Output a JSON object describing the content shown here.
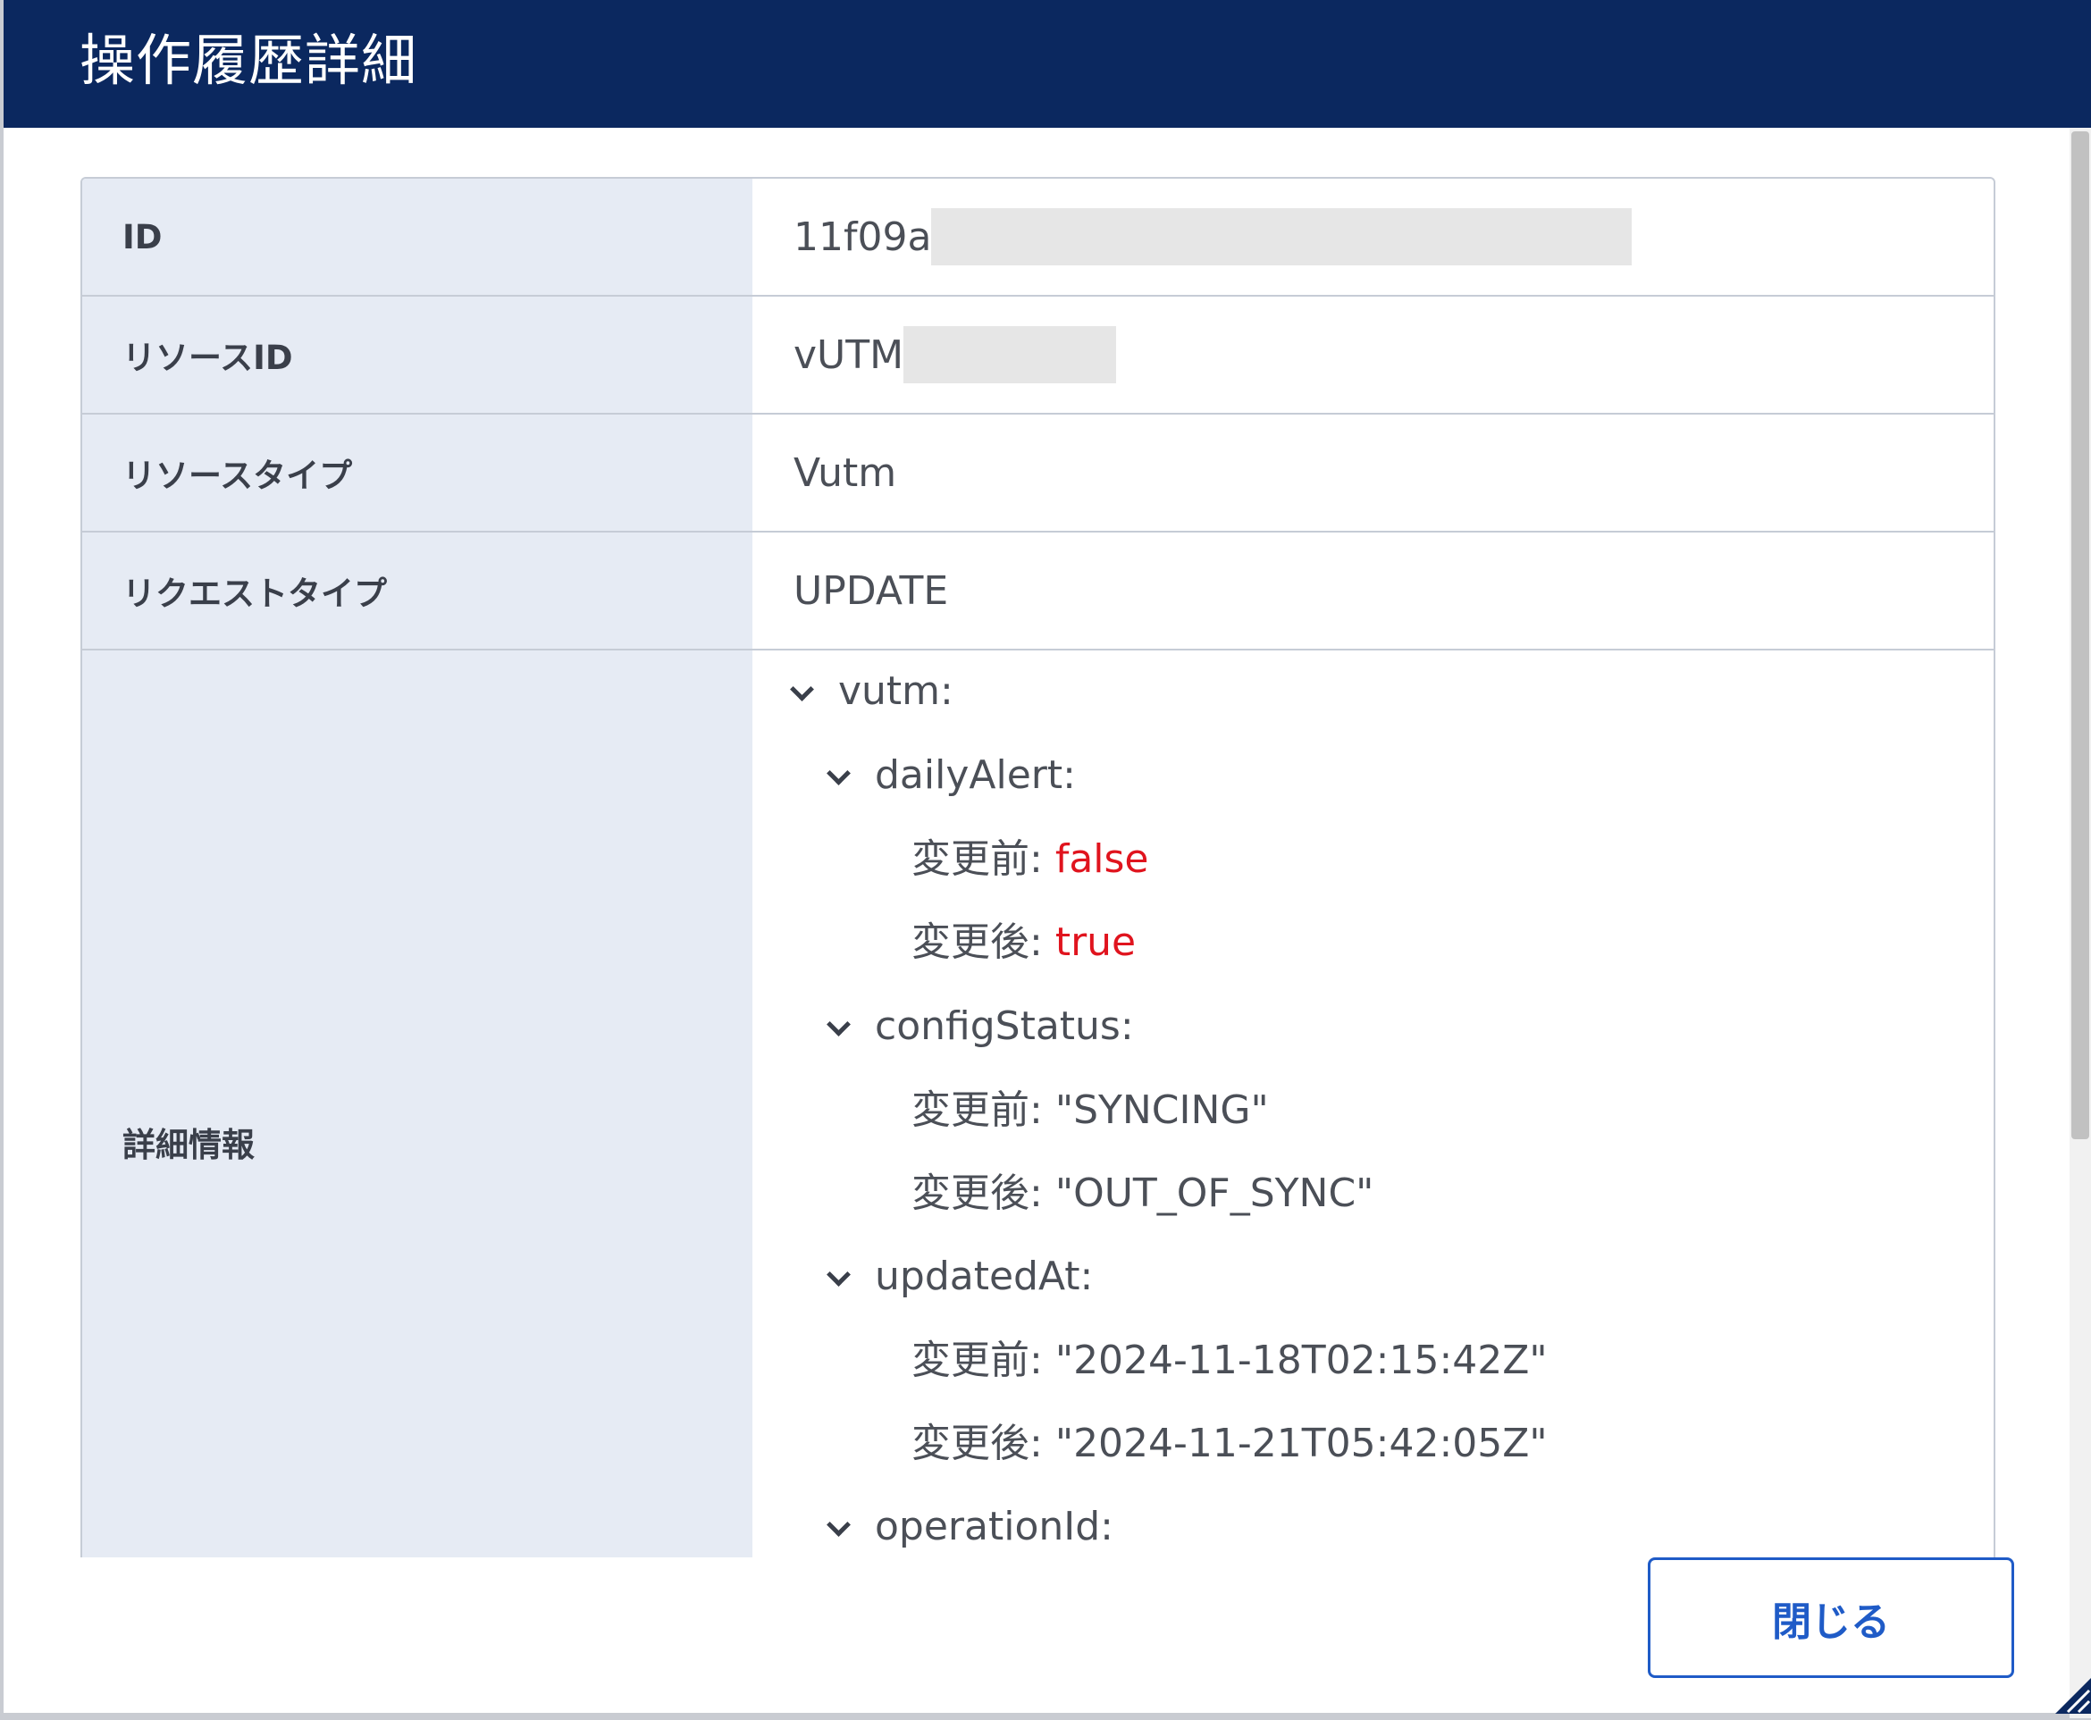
{
  "dialog": {
    "title": "操作履歴詳細",
    "close_label": "閉じる"
  },
  "fields": [
    {
      "label": "ID",
      "value": "11f09a"
    },
    {
      "label": "リソースID",
      "value": "vUTM"
    },
    {
      "label": "リソースタイプ",
      "value": "Vutm"
    },
    {
      "label": "リクエストタイプ",
      "value": "UPDATE"
    }
  ],
  "details": {
    "label": "詳細情報",
    "root": "vutm:",
    "dailyAlert": {
      "key": "dailyAlert:",
      "before_label": "変更前:",
      "before_value": "false",
      "after_label": "変更後:",
      "after_value": "true"
    },
    "configStatus": {
      "key": "configStatus:",
      "before_label": "変更前:",
      "before_value": "\"SYNCING\"",
      "after_label": "変更後:",
      "after_value": "\"OUT_OF_SYNC\""
    },
    "updatedAt": {
      "key": "updatedAt:",
      "before_label": "変更前:",
      "before_value": "\"2024-11-18T02:15:42Z\"",
      "after_label": "変更後:",
      "after_value": "\"2024-11-21T05:42:05Z\""
    },
    "operationId": {
      "key": "operationId:"
    }
  },
  "colors": {
    "header_bg": "#0b285f",
    "label_bg": "#e6ebf4",
    "accent": "#1f5bc7",
    "boolean_value": "#e0141e"
  }
}
